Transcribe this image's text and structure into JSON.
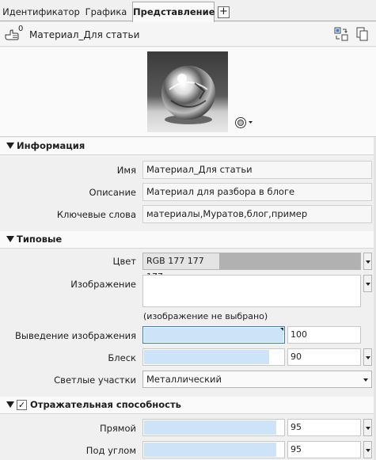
{
  "tabs": {
    "items": [
      "Идентификатор",
      "Графика",
      "Представление"
    ],
    "add_label": "+"
  },
  "header": {
    "instance_count": "0",
    "material_name": "Материал_Для статьи"
  },
  "info": {
    "title": "Информация",
    "name_label": "Имя",
    "name_value": "Материал_Для статьи",
    "desc_label": "Описание",
    "desc_value": "Материал для разбора в блоге",
    "keywords_label": "Ключевые слова",
    "keywords_value": "материалы,Муратов,блог,пример"
  },
  "generic": {
    "title": "Типовые",
    "color_label": "Цвет",
    "color_value": "RGB 177 177 177",
    "color_hex": "#b1b1b1",
    "image_label": "Изображение",
    "image_note": "(изображение не выбрано)",
    "fade_label": "Выведение изображения",
    "fade_value": "100",
    "fade_level": 1.0,
    "gloss_label": "Блеск",
    "gloss_value": "90",
    "gloss_level": 0.9,
    "highlights_label": "Светлые участки",
    "highlights_value": "Металлический"
  },
  "reflectivity": {
    "title": "Отражательная способность",
    "checked": true,
    "direct_label": "Прямой",
    "direct_value": "95",
    "direct_level": 0.95,
    "oblique_label": "Под углом",
    "oblique_value": "95",
    "oblique_level": 0.95
  },
  "colors": {
    "accent": "#2f7ecf",
    "slider_fill": "#cde3f7"
  }
}
